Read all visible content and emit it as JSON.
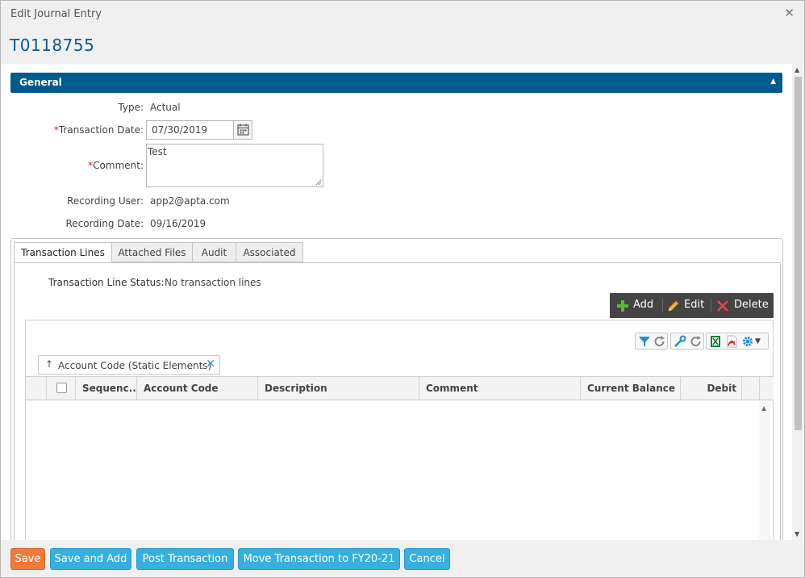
{
  "dialog": {
    "title": "Edit Journal Entry",
    "close_icon": "close-icon",
    "entry_id": "T0118755"
  },
  "general": {
    "title": "General",
    "fields": {
      "type": {
        "label": "Type:",
        "value": "Actual"
      },
      "transaction_date": {
        "required_mark": "*",
        "label": "Transaction Date:",
        "value": "07/30/2019"
      },
      "comment": {
        "required_mark": "*",
        "label": "Comment:",
        "value": "Test"
      },
      "recording_user": {
        "label": "Recording User:",
        "value": "app2@apta.com"
      },
      "recording_date": {
        "label": "Recording Date:",
        "value": "09/16/2019"
      }
    }
  },
  "tabs": [
    {
      "label": "Transaction Lines",
      "active": true
    },
    {
      "label": "Attached Files",
      "active": false
    },
    {
      "label": "Audit",
      "active": false
    },
    {
      "label": "Associated",
      "active": false
    }
  ],
  "transaction_lines": {
    "status_label": "Transaction Line Status:",
    "status_value": "No transaction lines",
    "actions": {
      "add": "Add",
      "edit": "Edit",
      "delete": "Delete"
    },
    "group_chip": "Account Code (Static Elements)",
    "columns": [
      "Sequenc...",
      "Account Code",
      "Description",
      "Comment",
      "Current Balance",
      "Debit"
    ]
  },
  "footer": {
    "save": "Save",
    "save_and_add": "Save and Add",
    "post": "Post Transaction",
    "move": "Move Transaction to FY20-21",
    "cancel": "Cancel"
  },
  "colors": {
    "accent": "#005a8e",
    "title_blue": "#0b5a92",
    "save_orange": "#ef7a3b",
    "button_blue": "#38b0de",
    "required_red": "#d9251c"
  }
}
